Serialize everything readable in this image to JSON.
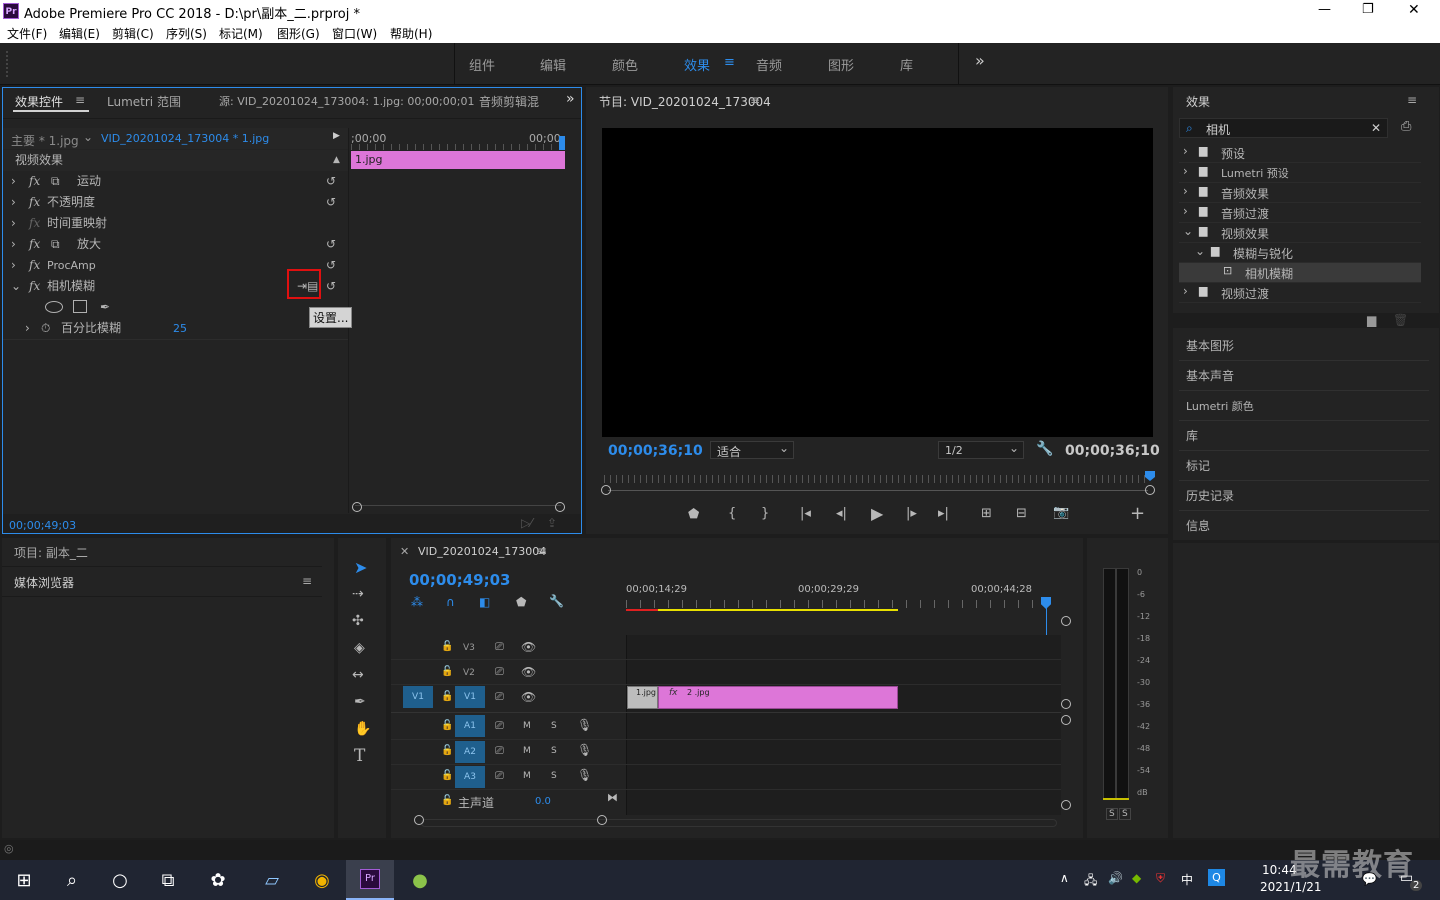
{
  "window": {
    "app_icon": "Pr",
    "title": "Adobe Premiere Pro CC 2018 - D:\\pr\\副本_二.prproj *",
    "minimize": "—",
    "maximize": "❐",
    "close": "✕"
  },
  "menu": [
    "文件(F)",
    "编辑(E)",
    "剪辑(C)",
    "序列(S)",
    "标记(M)",
    "图形(G)",
    "窗口(W)",
    "帮助(H)"
  ],
  "workspaces": [
    "组件",
    "编辑",
    "颜色",
    "效果",
    "音频",
    "图形",
    "库"
  ],
  "workspaces_more": "»",
  "effect_controls": {
    "tabs": [
      "效果控件",
      "Lumetri 范围",
      "源: VID_20201024_173004: 1.jpg: 00;00;00;01",
      "音频剪辑混"
    ],
    "master_label": "主要 * 1.jpg",
    "clip_label": "VID_20201024_173004 * 1.jpg",
    "timecode_start": ";00;00",
    "timecode_end": "00;00",
    "clip_name": "1.jpg",
    "section": "视频效果",
    "effects": [
      "运动",
      "不透明度",
      "时间重映射",
      "放大",
      "ProcAmp",
      "相机模糊"
    ],
    "param_name": "百分比模糊",
    "param_value": "25",
    "tooltip": "设置...",
    "footer_time": "00;00;49;03"
  },
  "program": {
    "title": "节目: VID_20201024_173004",
    "timecode_left": "00;00;36;10",
    "fit": "适合",
    "resolution": "1/2",
    "timecode_right": "00;00;36;10"
  },
  "effects_panel": {
    "title": "效果",
    "search_value": "相机",
    "clear": "✕",
    "tree": [
      {
        "label": "预设",
        "level": 0,
        "kind": "star-folder",
        "open": false
      },
      {
        "label": "Lumetri 预设",
        "level": 0,
        "kind": "star-folder",
        "open": false
      },
      {
        "label": "音频效果",
        "level": 0,
        "kind": "folder",
        "open": false
      },
      {
        "label": "音频过渡",
        "level": 0,
        "kind": "folder",
        "open": false
      },
      {
        "label": "视频效果",
        "level": 0,
        "kind": "folder",
        "open": true
      },
      {
        "label": "模糊与锐化",
        "level": 1,
        "kind": "folder",
        "open": true
      },
      {
        "label": "相机模糊",
        "level": 2,
        "kind": "effect",
        "open": false
      },
      {
        "label": "视频过渡",
        "level": 0,
        "kind": "folder",
        "open": false
      }
    ],
    "collapsed_panels": [
      "基本图形",
      "基本声音",
      "Lumetri 颜色",
      "库",
      "标记",
      "历史记录",
      "信息"
    ]
  },
  "project": {
    "tab1": "项目: 副本_二",
    "tab2": "媒体浏览器"
  },
  "timeline": {
    "title": "VID_20201024_173004",
    "timecode": "00;00;49;03",
    "ruler": [
      "00;00;14;29",
      "00;00;29;29",
      "00;00;44;28"
    ],
    "video_tracks": [
      "V3",
      "V2",
      "V1"
    ],
    "audio_tracks": [
      "A1",
      "A2",
      "A3"
    ],
    "source_video": "V1",
    "mute": "M",
    "solo": "S",
    "clip1": "1.jpg",
    "clip2": "2 .jpg",
    "master": "主声道",
    "master_value": "0.0"
  },
  "meter": {
    "scale": [
      "0",
      "-6",
      "-12",
      "-18",
      "-24",
      "-30",
      "-36",
      "-42",
      "-48",
      "-54",
      "dB"
    ],
    "solo": [
      "S",
      "S"
    ]
  },
  "taskbar": {
    "time": "10:44",
    "date": "2021/1/21",
    "ime": "中",
    "notification_count": "2",
    "watermark": "最需教育"
  }
}
